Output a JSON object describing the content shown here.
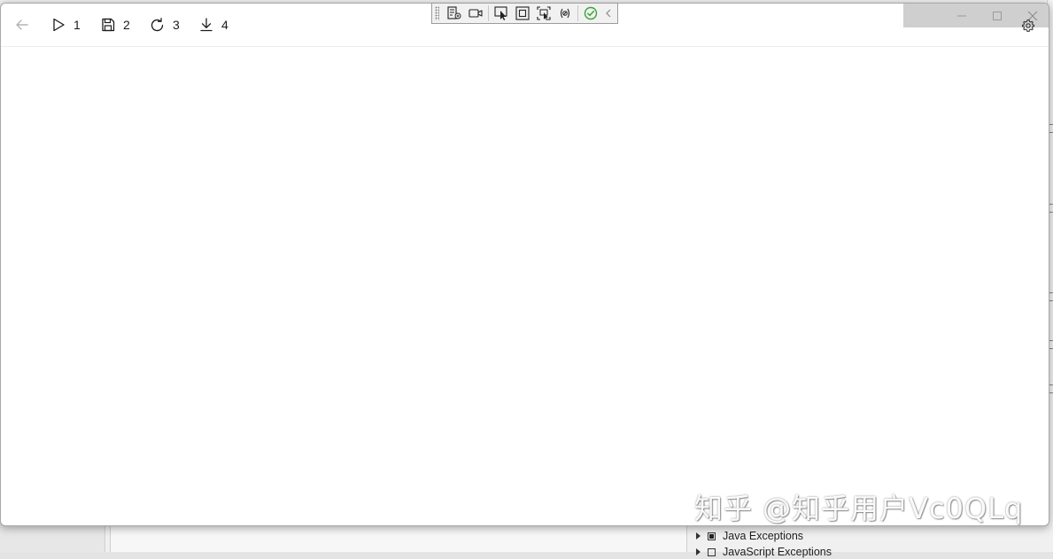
{
  "toolbar": {
    "back_icon": "arrow-left-icon",
    "items": [
      {
        "icon": "play-icon",
        "label": "1"
      },
      {
        "icon": "save-icon",
        "label": "2"
      },
      {
        "icon": "refresh-icon",
        "label": "3"
      },
      {
        "icon": "download-icon",
        "label": "4"
      }
    ],
    "settings_icon": "gear-icon"
  },
  "window_controls": [
    "minimize-icon",
    "maximize-icon",
    "close-icon"
  ],
  "debug_toolbar": {
    "icons": [
      "live-visual-tree-icon",
      "record-icon",
      "select-element-icon",
      "display-layout-adorners-icon",
      "track-focused-element-icon",
      "binding-failures-icon",
      "hot-reload-ok-icon",
      "collapse-toolbar-icon"
    ],
    "ok_color": "#3aa335"
  },
  "background": {
    "exceptions": [
      {
        "label": "Java Exceptions",
        "checked": true
      },
      {
        "label": "JavaScript Exceptions",
        "checked": false
      }
    ]
  },
  "watermark": "知乎 @知乎用户Vc0QLq"
}
